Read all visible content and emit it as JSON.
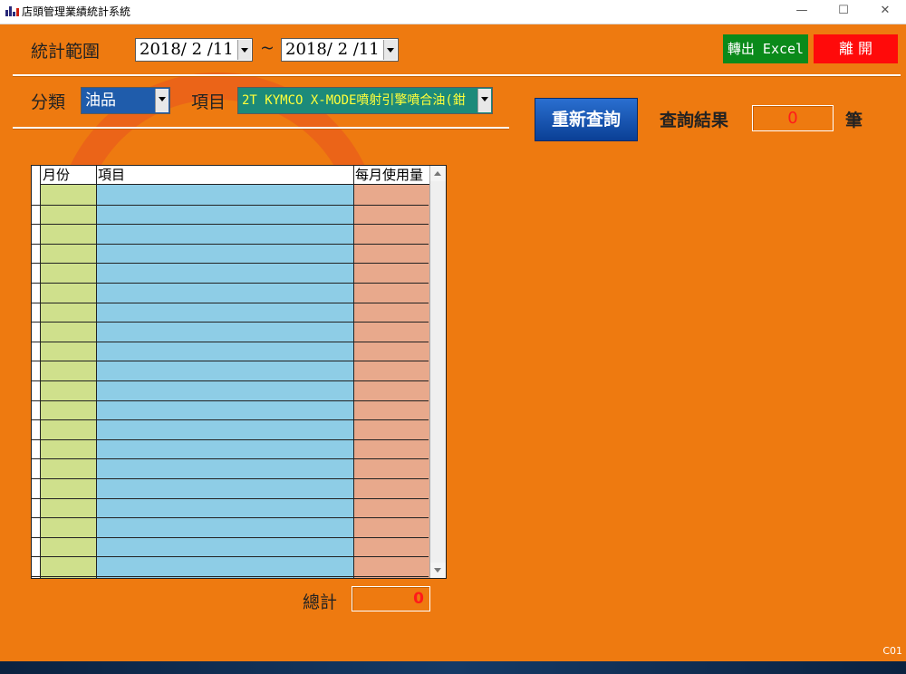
{
  "window": {
    "title": "店頭管理業績統計系統",
    "minimize": "—",
    "maximize": "☐",
    "close": "✕"
  },
  "filters": {
    "range_label": "統計範圍",
    "date_from": "2018/ 2 /11",
    "tilde": "~",
    "date_to": "2018/ 2 /11",
    "category_label": "分類",
    "category_value": "油品",
    "item_label": "項目",
    "item_value": "2T  KYMCO X-MODE噴射引擎噴合油(鉗"
  },
  "buttons": {
    "export": "轉出 Excel",
    "exit": "離 開",
    "requery": "重新查詢"
  },
  "result": {
    "label": "查詢結果",
    "count": "0",
    "unit": "筆"
  },
  "grid": {
    "columns": [
      "月份",
      "項目",
      "每月使用量"
    ],
    "row_count": 20
  },
  "total": {
    "label": "總計",
    "value": "0"
  },
  "footer_code": "C01",
  "colors": {
    "background": "#ee7a10",
    "month_column": "#cfe08c",
    "item_column": "#8ecde6",
    "usage_column": "#e8a98c",
    "export_button": "#0a8a1a",
    "exit_button": "#ff0a0a",
    "requery_button": "#0a4aa8",
    "category_combo": "#1f5cab",
    "item_combo": "#1c8a7a"
  }
}
